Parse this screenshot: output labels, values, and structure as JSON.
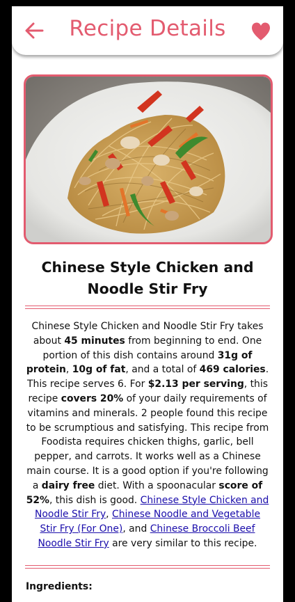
{
  "header": {
    "title": "Recipe Details",
    "accent_color": "#e35b6f",
    "back_icon": "arrow-left-icon",
    "favorite_icon": "heart-icon"
  },
  "recipe": {
    "title": "Chinese Style Chicken and Noodle Stir Fry",
    "image_alt": "stir fry noodles with peppers and chicken on a white plate",
    "summary": {
      "p1": "Chinese Style Chicken and Noodle Stir Fry takes about ",
      "time": "45 minutes",
      "p2": " from beginning to end. One portion of this dish contains around ",
      "protein": "31g of protein",
      "p3": ", ",
      "fat": "10g of fat",
      "p4": ", and a total of ",
      "calories": "469 calories",
      "p5": ". This recipe serves 6. For ",
      "price": "$2.13 per serving",
      "p6": ", this recipe ",
      "covers": "covers 20%",
      "p7": " of your daily requirements of vitamins and minerals. 2 people found this recipe to be scrumptious and satisfying. This recipe from Foodista requires chicken thighs, garlic, bell pepper, and carrots. It works well as a Chinese main course. It is a good option if you're following a ",
      "diet": "dairy free",
      "p8": " diet. With a spoonacular ",
      "score": "score of 52%",
      "p9": ", this dish is good. ",
      "link1": "Chinese Style Chicken and Noodle Stir Fry",
      "p10": ", ",
      "link2": "Chinese Noodle and Vegetable Stir Fry (For One)",
      "p11": ", and ",
      "link3": "Chinese Broccoli Beef Noodle Stir Fry",
      "p12": " are very similar to this recipe."
    }
  },
  "sections": {
    "ingredients_label": "Ingredients:"
  }
}
